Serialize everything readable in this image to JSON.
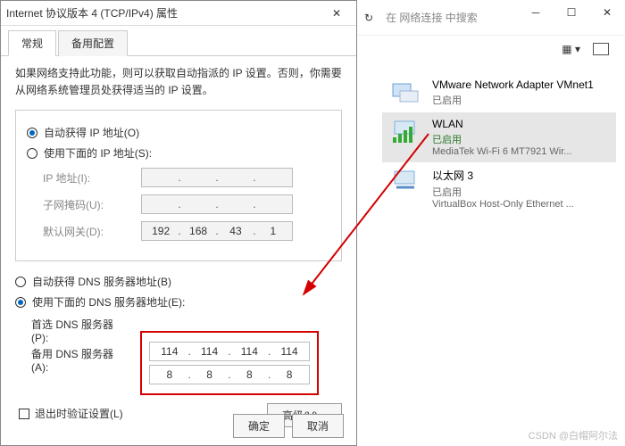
{
  "dialog": {
    "title": "Internet 协议版本 4 (TCP/IPv4) 属性",
    "tabs": [
      "常规",
      "备用配置"
    ],
    "description": "如果网络支持此功能，则可以获取自动指派的 IP 设置。否则，你需要从网络系统管理员处获得适当的 IP 设置。",
    "ip_auto": "自动获得 IP 地址(O)",
    "ip_manual": "使用下面的 IP 地址(S):",
    "ip_label": "IP 地址(I):",
    "mask_label": "子网掩码(U):",
    "gw_label": "默认网关(D):",
    "gw_value": [
      "192",
      "168",
      "43",
      "1"
    ],
    "dns_auto": "自动获得 DNS 服务器地址(B)",
    "dns_manual": "使用下面的 DNS 服务器地址(E):",
    "dns_pref_label": "首选 DNS 服务器(P):",
    "dns_alt_label": "备用 DNS 服务器(A):",
    "dns_pref": [
      "114",
      "114",
      "114",
      "114"
    ],
    "dns_alt": [
      "8",
      "8",
      "8",
      "8"
    ],
    "validate": "退出时验证设置(L)",
    "advanced": "高级(V)...",
    "ok": "确定",
    "cancel": "取消"
  },
  "explorer": {
    "search_placeholder": "在 网络连接 中搜索",
    "items": [
      {
        "name": "VMware Network Adapter VMnet1",
        "status": "已启用",
        "device": ""
      },
      {
        "name": "WLAN",
        "status": "已启用",
        "device": "MediaTek Wi-Fi 6 MT7921 Wir..."
      },
      {
        "name": "以太网 3",
        "status": "已启用",
        "device": "VirtualBox Host-Only Ethernet ..."
      }
    ]
  },
  "watermark": "CSDN @白帽阿尔法"
}
